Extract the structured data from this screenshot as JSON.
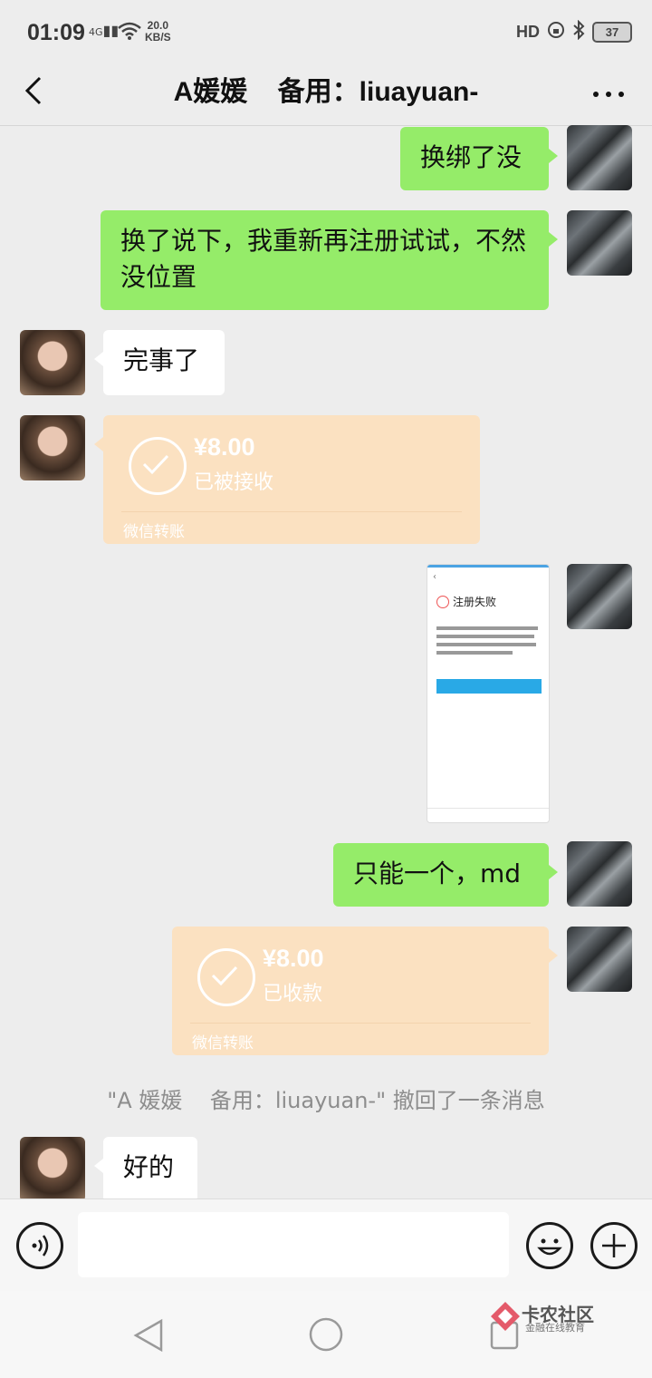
{
  "status_bar": {
    "time": "01:09",
    "network": "4G",
    "speed_value": "20.0",
    "speed_unit": "KB/S",
    "battery": "37"
  },
  "header": {
    "title": "A媛媛    备用：liuayuan-"
  },
  "messages": [
    {
      "text": "换绑了没"
    },
    {
      "text": "换了说下，我重新再注册试试，不然没位置"
    },
    {
      "text": "完事了"
    },
    {
      "amount": "¥8.00",
      "status": "已被接收",
      "footer": "微信转账"
    },
    {
      "screenshot_title": "注册失败"
    },
    {
      "text": "只能一个，md"
    },
    {
      "amount": "¥8.00",
      "status": "已收款",
      "footer": "微信转账"
    },
    {
      "text": "好的"
    }
  ],
  "system_notice": "\"A 媛媛    备用：liuayuan-\" 撤回了一条消息",
  "watermark": {
    "title": "卡农社区",
    "subtitle": "金融在线教育"
  }
}
